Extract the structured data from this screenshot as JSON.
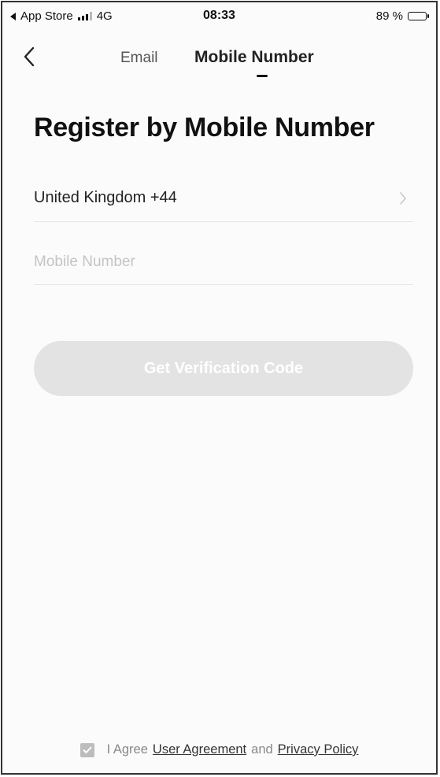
{
  "status_bar": {
    "carrier_app": "App Store",
    "network": "4G",
    "time": "08:33",
    "battery": "89 %",
    "battery_level": 0.89
  },
  "nav": {
    "back_icon": "chevron-left-icon",
    "tabs": [
      {
        "label": "Email",
        "active": false
      },
      {
        "label": "Mobile Number",
        "active": true
      }
    ]
  },
  "page": {
    "title": "Register by Mobile Number"
  },
  "form": {
    "country": {
      "label": "United Kingdom +44",
      "icon": "chevron-right-icon"
    },
    "mobile": {
      "value": "",
      "placeholder": "Mobile Number"
    },
    "submit": {
      "label": "Get Verification Code",
      "enabled": false
    }
  },
  "agreement": {
    "checked": true,
    "prefix": "I Agree",
    "user_agreement": "User Agreement",
    "conjunction": "and",
    "privacy_policy": "Privacy Policy"
  },
  "colors": {
    "button_disabled_bg": "#e3e3e3",
    "checkbox_bg": "#bdbdbd",
    "placeholder": "#c4c4c4"
  }
}
